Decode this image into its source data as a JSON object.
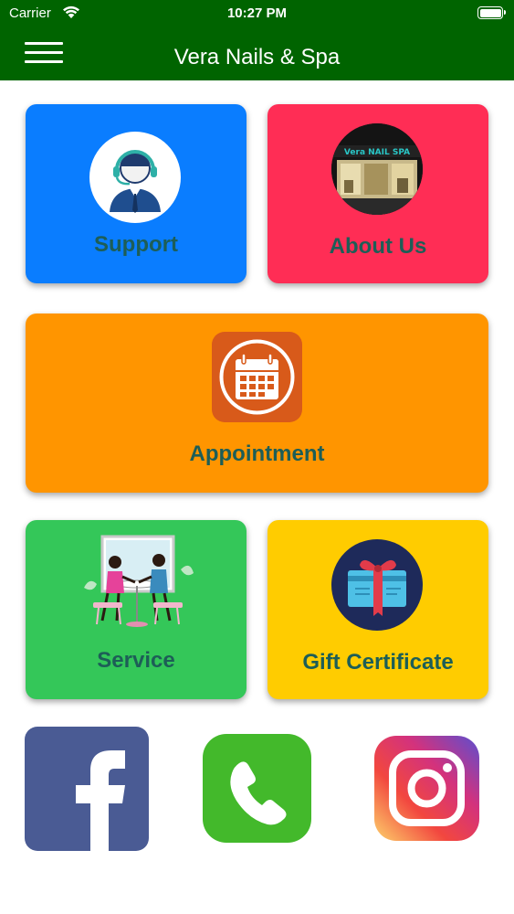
{
  "status_bar": {
    "carrier": "Carrier",
    "time": "10:27 PM"
  },
  "navbar": {
    "title": "Vera Nails & Spa",
    "menu_icon": "hamburger-menu-icon"
  },
  "tiles": {
    "support": {
      "label": "Support",
      "icon": "support-agent-icon",
      "color": "#0a7dff"
    },
    "about": {
      "label": "About Us",
      "icon": "storefront-photo",
      "color": "#ff2d55"
    },
    "appointment": {
      "label": "Appointment",
      "icon": "calendar-icon",
      "color": "#ff9500"
    },
    "service": {
      "label": "Service",
      "icon": "manicure-illustration",
      "color": "#34c759"
    },
    "gift": {
      "label": "Gift Certificate",
      "icon": "gift-card-icon",
      "color": "#ffcc00"
    }
  },
  "storefront_sign": "Vera NAIL SPA",
  "social": [
    {
      "name": "Facebook",
      "icon": "facebook-icon",
      "color": "#4a5b94"
    },
    {
      "name": "Phone",
      "icon": "phone-icon",
      "color": "#43b92b"
    },
    {
      "name": "Instagram",
      "icon": "instagram-icon",
      "color": "#d3327d"
    }
  ],
  "theme": {
    "header": "#006400",
    "label_text": "#1d5e57"
  }
}
